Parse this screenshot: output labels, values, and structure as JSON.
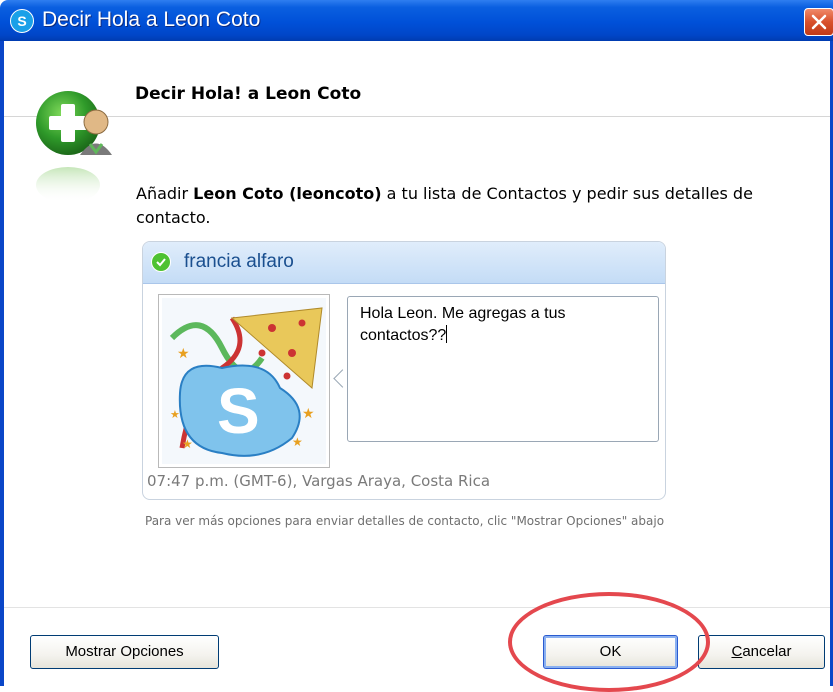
{
  "window": {
    "title": "Decir Hola a Leon Coto",
    "app_icon_letter": "S",
    "accent_color": "#0050d8"
  },
  "header": {
    "title": "Decir Hola! a Leon Coto",
    "icon": "add-contact-icon"
  },
  "intro": {
    "prefix": "Añadir ",
    "contact_bold": "Leon Coto (leoncoto)",
    "suffix": " a tu lista de Contactos y pedir sus detalles de contacto."
  },
  "card": {
    "sender_name": "francia alfaro",
    "status_icon": "online-status-icon",
    "message": "Hola Leon. Me agregas a tus contactos??",
    "footer": "07:47 p.m. (GMT-6), Vargas Araya, Costa Rica"
  },
  "hint": "Para ver más opciones para enviar detalles de contacto, clic \"Mostrar Opciones\" abajo",
  "buttons": {
    "mostrar": "Mostrar Opciones",
    "ok": "OK",
    "cancel_first": "C",
    "cancel_rest": "ancelar"
  },
  "annotation": {
    "shape": "ellipse",
    "color": "#e4484e"
  }
}
